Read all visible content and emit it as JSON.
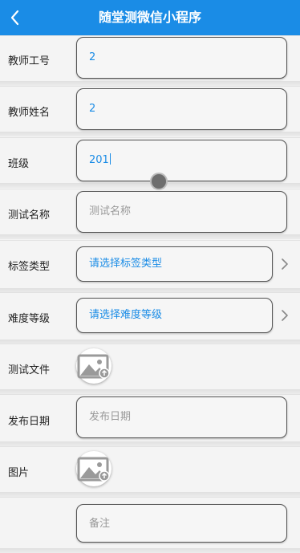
{
  "header": {
    "title": "随堂测微信小程序",
    "back_icon": "chevron-left-icon"
  },
  "form": {
    "teacher_id": {
      "label": "教师工号",
      "value": "2"
    },
    "teacher_name": {
      "label": "教师姓名",
      "value": "2"
    },
    "class": {
      "label": "班级",
      "value": "201"
    },
    "test_name": {
      "label": "测试名称",
      "placeholder": "测试名称"
    },
    "tag_type": {
      "label": "标签类型",
      "value": "请选择标签类型"
    },
    "difficulty": {
      "label": "难度等级",
      "value": "请选择难度等级"
    },
    "test_file": {
      "label": "测试文件",
      "icon": "image-upload-icon"
    },
    "publish_date": {
      "label": "发布日期",
      "placeholder": "发布日期"
    },
    "image": {
      "label": "图片",
      "icon": "image-upload-icon"
    },
    "remark": {
      "label": "",
      "placeholder": "备注"
    }
  },
  "colors": {
    "accent": "#1a8ce6",
    "background": "#f4f4f4"
  }
}
